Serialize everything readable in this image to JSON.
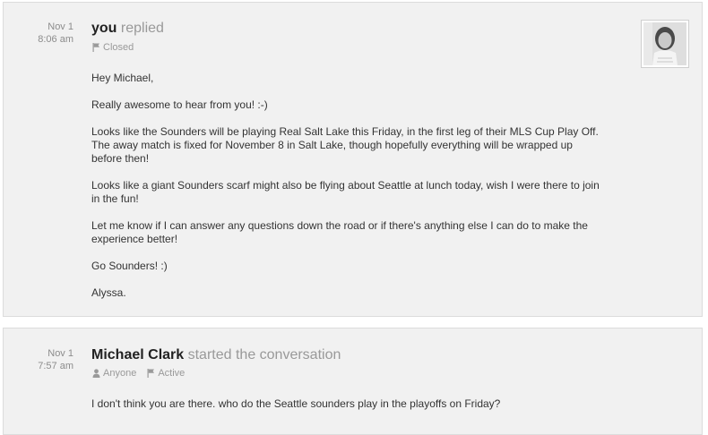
{
  "messages": [
    {
      "date": "Nov 1",
      "time": "8:06 am",
      "author": "you",
      "action": "replied",
      "status": {
        "icon": "flag-icon",
        "label": "Closed"
      },
      "avatar_icon": "user-photo",
      "paragraphs": [
        "Hey Michael,",
        "Really awesome to hear from you! :-)",
        "Looks like the Sounders will be playing Real Salt Lake this Friday, in the first leg of their MLS Cup Play Off. The away match is fixed for November 8 in Salt Lake, though hopefully everything will be wrapped up before then!",
        "Looks like a giant Sounders scarf might also be flying about Seattle at lunch today, wish I were there to join in the fun!",
        "Let me know if I can answer any questions down the road or if there's anything else I can do to make the experience better!",
        "Go Sounders! :)",
        "Alyssa."
      ]
    },
    {
      "date": "Nov 1",
      "time": "7:57 am",
      "author": "Michael Clark",
      "action": "started the conversation",
      "assignee": {
        "icon": "person-icon",
        "label": "Anyone"
      },
      "status": {
        "icon": "flag-icon",
        "label": "Active"
      },
      "paragraphs": [
        "I don't think you are there. who do the Seattle sounders play in the playoffs on Friday?"
      ]
    }
  ]
}
